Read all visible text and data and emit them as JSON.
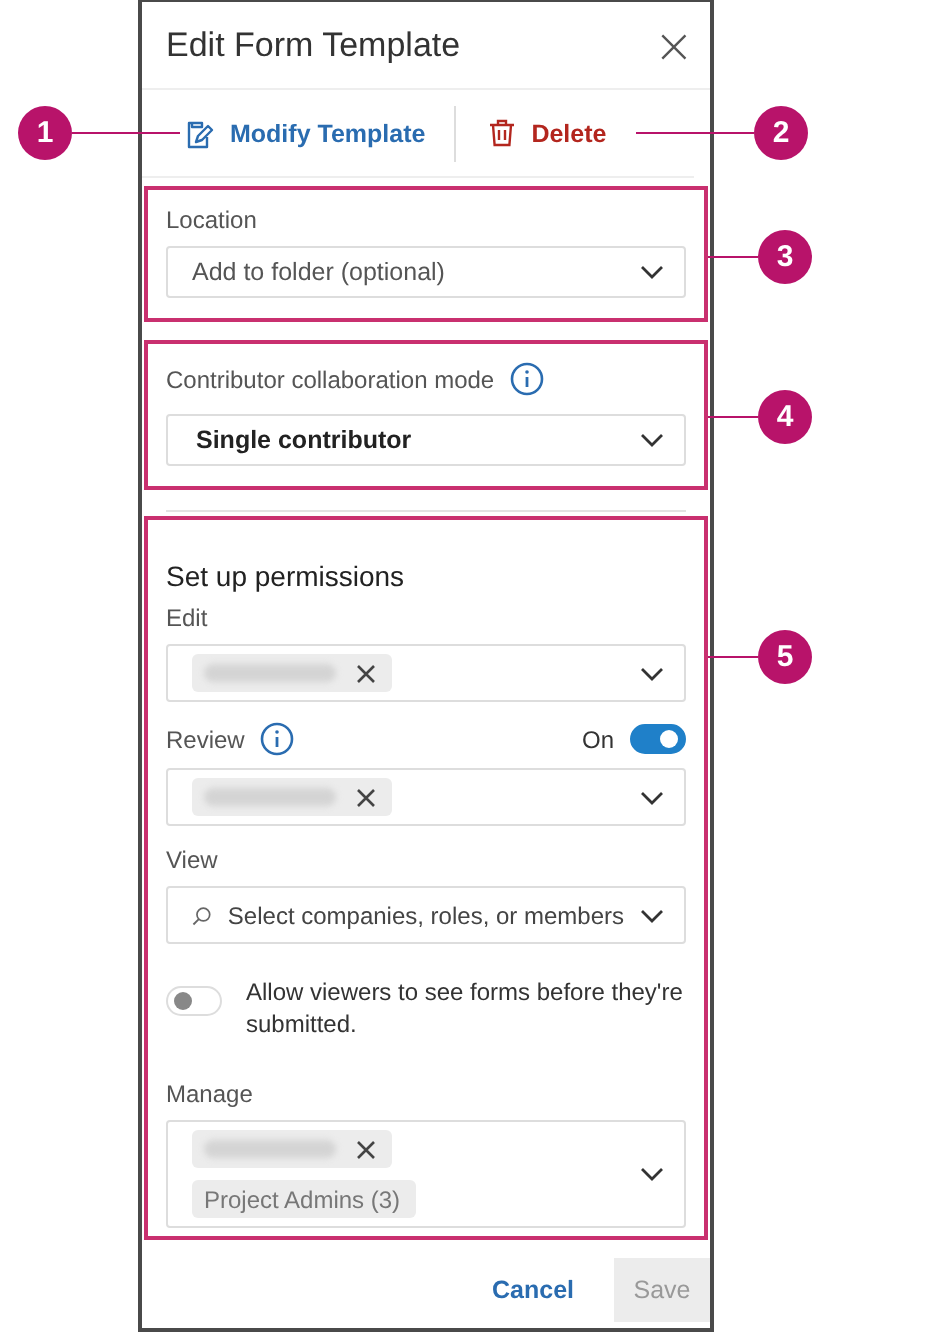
{
  "dialog": {
    "title": "Edit Form Template",
    "close": "×"
  },
  "actions": [
    {
      "kind": "modify",
      "label": "Modify Template"
    },
    {
      "kind": "delete",
      "label": "Delete"
    }
  ],
  "location": {
    "label": "Location",
    "placeholder": "Add to folder (optional)"
  },
  "collaboration": {
    "label": "Contributor collaboration mode",
    "value": "Single contributor"
  },
  "permissions": {
    "title": "Set up permissions",
    "fields": [
      {
        "kind": "chips",
        "label": "Edit",
        "chips": [
          {
            "kind": "redacted",
            "removable": true
          }
        ]
      },
      {
        "kind": "chips",
        "label": "Review",
        "info": true,
        "toggle_label": "On",
        "on": true,
        "chips": [
          {
            "kind": "redacted",
            "removable": true
          }
        ]
      },
      {
        "kind": "search",
        "label": "View",
        "placeholder": "Select companies, roles, or members"
      },
      {
        "kind": "switch",
        "label": "Allow viewers to see forms before they're submitted.",
        "on": false
      },
      {
        "kind": "chips",
        "label": "Manage",
        "chips": [
          {
            "kind": "redacted",
            "removable": true
          },
          {
            "kind": "text",
            "text": "Project Admins (3)",
            "removable": false
          }
        ]
      }
    ]
  },
  "footer": {
    "cancel": "Cancel",
    "save": "Save",
    "save_disabled": true
  },
  "callouts": [
    {
      "number": "1"
    },
    {
      "number": "2"
    },
    {
      "number": "3"
    },
    {
      "number": "4"
    },
    {
      "number": "5"
    }
  ]
}
